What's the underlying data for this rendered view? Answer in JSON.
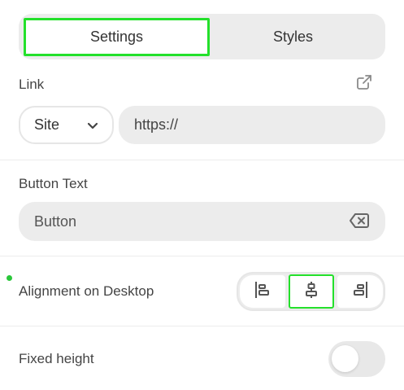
{
  "tabs": [
    {
      "label": "Settings",
      "active": true
    },
    {
      "label": "Styles",
      "active": false
    }
  ],
  "link": {
    "label": "Link",
    "external_icon": "external-link-icon",
    "type_select": {
      "value": "Site",
      "icon": "chevron-down-icon"
    },
    "url_input": {
      "value": "https://",
      "placeholder": ""
    }
  },
  "button_text": {
    "label": "Button Text",
    "value": "Button",
    "clear_icon": "backspace-clear-icon"
  },
  "alignment": {
    "label": "Alignment on Desktop",
    "options": [
      "left",
      "center",
      "right"
    ],
    "selected": "center",
    "indicator_color": "#2ac73a"
  },
  "fixed_height": {
    "label": "Fixed height",
    "enabled": false
  },
  "accent_color": "#24e02b"
}
